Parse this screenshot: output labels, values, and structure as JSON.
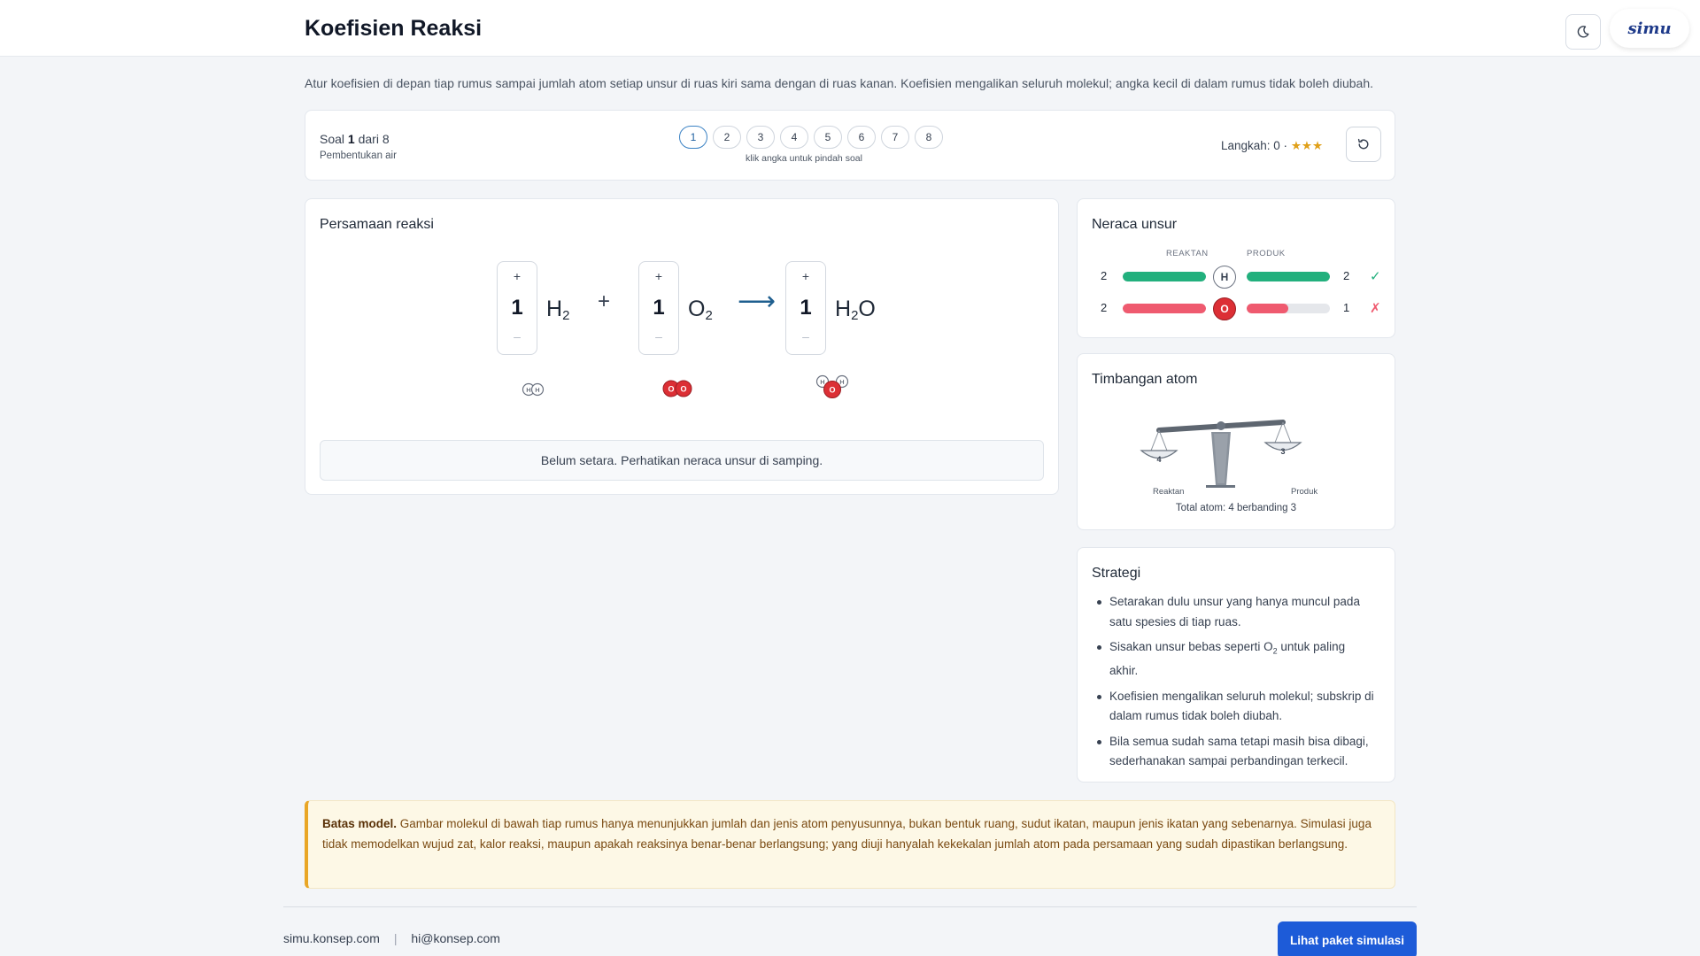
{
  "header": {
    "title": "Koefisien Reaksi",
    "theme_icon": "moon-icon",
    "brand": "simu"
  },
  "intro": "Atur koefisien di depan tiap rumus sampai jumlah atom setiap unsur di ruas kiri sama dengan di ruas kanan. Koefisien mengalikan seluruh molekul; angka kecil di dalam rumus tidak boleh diubah.",
  "nav": {
    "soal_prefix": "Soal",
    "current": "1",
    "soal_suffix": "dari 8",
    "subtitle": "Pembentukan air",
    "pills": [
      "1",
      "2",
      "3",
      "4",
      "5",
      "6",
      "7",
      "8"
    ],
    "hint": "klik angka untuk pindah soal",
    "steps_label": "Langkah: 0 ·",
    "stars": "★★★",
    "reset_icon": "reset-icon"
  },
  "equation": {
    "title": "Persamaan reaksi",
    "increment": "+",
    "decrement": "–",
    "plus_op": "+",
    "arrow": "⟶",
    "terms": [
      {
        "coef": "1",
        "el1": "H",
        "sub1": "2",
        "el2": "",
        "atoms": [
          {
            "symbol": "H",
            "color": "#ffffff"
          },
          {
            "symbol": "H",
            "color": "#ffffff"
          }
        ]
      },
      {
        "coef": "1",
        "el1": "O",
        "sub1": "2",
        "el2": "",
        "atoms": [
          {
            "symbol": "O",
            "color": "#dc2f35"
          },
          {
            "symbol": "O",
            "color": "#dc2f35"
          }
        ]
      },
      {
        "coef": "1",
        "el1": "H",
        "sub1": "2",
        "el2": "O",
        "atoms": [
          {
            "symbol": "H",
            "color": "#ffffff"
          },
          {
            "symbol": "O",
            "color": "#dc2f35"
          },
          {
            "symbol": "H",
            "color": "#ffffff"
          }
        ]
      }
    ],
    "status": "Belum setara. Perhatikan neraca unsur di samping."
  },
  "balance": {
    "title": "Neraca unsur",
    "reactant_label": "REAKTAN",
    "product_label": "PRODUK",
    "rows": [
      {
        "element": "H",
        "left": "2",
        "right": "2",
        "left_fraction": 1.0,
        "right_fraction": 1.0,
        "mark": "✓",
        "balanced": true
      },
      {
        "element": "O",
        "left": "2",
        "right": "1",
        "left_fraction": 1.0,
        "right_fraction": 0.5,
        "mark": "✗",
        "balanced": false
      }
    ],
    "colors": {
      "ok": "#22b07d",
      "bad": "#ef5a6f",
      "oxygen": "#dc2f35",
      "accent": "#1d5bd8"
    }
  },
  "scale": {
    "title": "Timbangan atom",
    "left_count": "4",
    "right_count": "3",
    "left_label": "Reaktan",
    "right_label": "Produk",
    "total": "Total atom: 4 berbanding 3"
  },
  "strategy": {
    "title": "Strategi",
    "item1": "Setarakan dulu unsur yang hanya muncul pada satu spesies di tiap ruas.",
    "item2_pre": "Sisakan unsur bebas seperti O",
    "item2_sub": "2",
    "item2_post": " untuk paling akhir.",
    "item3": "Koefisien mengalikan seluruh molekul; subskrip di dalam rumus tidak boleh diubah.",
    "item4": "Bila semua sudah sama tetapi masih bisa dibagi, sederhanakan sampai perbandingan terkecil."
  },
  "note": {
    "bold": "Batas model.",
    "text": " Gambar molekul di bawah tiap rumus hanya menunjukkan jumlah dan jenis atom penyusunnya, bukan bentuk ruang, sudut ikatan, maupun jenis ikatan yang sebenarnya. Simulasi juga tidak memodelkan wujud zat, kalor reaksi, maupun apakah reaksinya benar-benar berlangsung; yang diuji hanyalah kekekalan jumlah atom pada persamaan yang sudah dipastikan berlangsung."
  },
  "footer": {
    "site": "simu.konsep.com",
    "separator": "|",
    "email": "hi@konsep.com",
    "cta": "Lihat paket simulasi"
  }
}
